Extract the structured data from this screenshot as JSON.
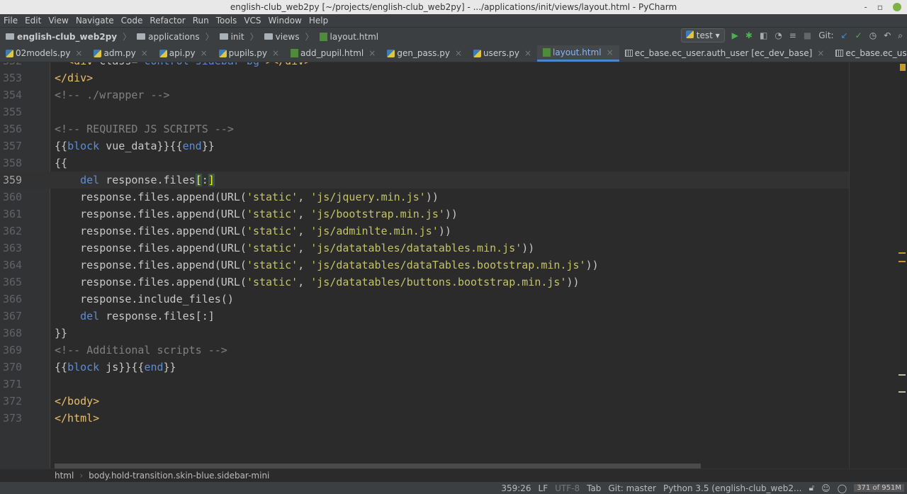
{
  "window": {
    "title": "english-club_web2py [~/projects/english-club_web2py] - .../applications/init/views/layout.html - PyCharm"
  },
  "menu": [
    "File",
    "Edit",
    "View",
    "Navigate",
    "Code",
    "Refactor",
    "Run",
    "Tools",
    "VCS",
    "Window",
    "Help"
  ],
  "breadcrumb": [
    "english-club_web2py",
    "applications",
    "init",
    "views",
    "layout.html"
  ],
  "toolbar": {
    "run_config": "test",
    "git_label": "Git:"
  },
  "tabs": [
    {
      "label": "02models.py",
      "icon": "python"
    },
    {
      "label": "adm.py",
      "icon": "python"
    },
    {
      "label": "api.py",
      "icon": "python"
    },
    {
      "label": "pupils.py",
      "icon": "python"
    },
    {
      "label": "add_pupil.html",
      "icon": "html"
    },
    {
      "label": "gen_pass.py",
      "icon": "python"
    },
    {
      "label": "users.py",
      "icon": "python"
    },
    {
      "label": "layout.html",
      "icon": "html",
      "active": true
    },
    {
      "label": "ec_base.ec_user.auth_user [ec_dev_base]",
      "icon": "table"
    },
    {
      "label": "ec_base.ec_user.group_pupils [ec_dev_bas",
      "icon": "table"
    }
  ],
  "code": [
    {
      "n": "352",
      "tokens": [
        [
          "tg",
          "  <div "
        ],
        [
          "p",
          "class="
        ],
        [
          "k",
          "\"control-sidebar-bg\""
        ],
        [
          "tg",
          "></div>"
        ]
      ]
    },
    {
      "n": "353",
      "tokens": [
        [
          "tg",
          "</div>"
        ]
      ]
    },
    {
      "n": "354",
      "tokens": [
        [
          "cm",
          "<!-- ./wrapper -->"
        ]
      ]
    },
    {
      "n": "355",
      "tokens": []
    },
    {
      "n": "356",
      "tokens": [
        [
          "cm",
          "<!-- REQUIRED JS SCRIPTS -->"
        ]
      ]
    },
    {
      "n": "357",
      "tokens": [
        [
          "p",
          "{{"
        ],
        [
          "k",
          "block"
        ],
        [
          "p",
          " vue_data}}{{"
        ],
        [
          "k",
          "end"
        ],
        [
          "p",
          "}}"
        ]
      ]
    },
    {
      "n": "358",
      "tokens": [
        [
          "p",
          "{{"
        ]
      ]
    },
    {
      "n": "359",
      "cur": true,
      "tokens": [
        [
          "p",
          "    "
        ],
        [
          "k",
          "del"
        ],
        [
          "p",
          " response.files"
        ],
        [
          "br",
          "["
        ],
        [
          "p",
          ":"
        ],
        [
          "br",
          "]"
        ]
      ]
    },
    {
      "n": "360",
      "tokens": [
        [
          "p",
          "    response.files.append(URL("
        ],
        [
          "s",
          "'static'"
        ],
        [
          "p",
          ", "
        ],
        [
          "s",
          "'js/jquery.min.js'"
        ],
        [
          "p",
          "))"
        ]
      ]
    },
    {
      "n": "361",
      "tokens": [
        [
          "p",
          "    response.files.append(URL("
        ],
        [
          "s",
          "'static'"
        ],
        [
          "p",
          ", "
        ],
        [
          "s",
          "'js/bootstrap.min.js'"
        ],
        [
          "p",
          "))"
        ]
      ]
    },
    {
      "n": "362",
      "tokens": [
        [
          "p",
          "    response.files.append(URL("
        ],
        [
          "s",
          "'static'"
        ],
        [
          "p",
          ", "
        ],
        [
          "s",
          "'js/adminlte.min.js'"
        ],
        [
          "p",
          "))"
        ]
      ]
    },
    {
      "n": "363",
      "tokens": [
        [
          "p",
          "    response.files.append(URL("
        ],
        [
          "s",
          "'static'"
        ],
        [
          "p",
          ", "
        ],
        [
          "s",
          "'js/datatables/datatables.min.js'"
        ],
        [
          "p",
          "))"
        ]
      ]
    },
    {
      "n": "364",
      "tokens": [
        [
          "p",
          "    response.files.append(URL("
        ],
        [
          "s",
          "'static'"
        ],
        [
          "p",
          ", "
        ],
        [
          "s",
          "'js/datatables/dataTables.bootstrap.min.js'"
        ],
        [
          "p",
          "))"
        ]
      ]
    },
    {
      "n": "365",
      "tokens": [
        [
          "p",
          "    response.files.append(URL("
        ],
        [
          "s",
          "'static'"
        ],
        [
          "p",
          ", "
        ],
        [
          "s",
          "'js/datatables/buttons.bootstrap.min.js'"
        ],
        [
          "p",
          "))"
        ]
      ]
    },
    {
      "n": "366",
      "tokens": [
        [
          "p",
          "    response.include_files()"
        ]
      ]
    },
    {
      "n": "367",
      "tokens": [
        [
          "p",
          "    "
        ],
        [
          "k",
          "del"
        ],
        [
          "p",
          " response.files[:]"
        ]
      ]
    },
    {
      "n": "368",
      "tokens": [
        [
          "p",
          "}}"
        ]
      ]
    },
    {
      "n": "369",
      "tokens": [
        [
          "cm",
          "<!-- Additional scripts -->"
        ]
      ]
    },
    {
      "n": "370",
      "tokens": [
        [
          "p",
          "{{"
        ],
        [
          "k",
          "block"
        ],
        [
          "p",
          " js}}{{"
        ],
        [
          "k",
          "end"
        ],
        [
          "p",
          "}}"
        ]
      ]
    },
    {
      "n": "371",
      "tokens": []
    },
    {
      "n": "372",
      "tokens": [
        [
          "tg",
          "</body>"
        ]
      ]
    },
    {
      "n": "373",
      "tokens": [
        [
          "tg",
          "</html>"
        ]
      ]
    }
  ],
  "path_bar": [
    "html",
    "body.hold-transition.skin-blue.sidebar-mini"
  ],
  "status": {
    "position": "359:26",
    "line_sep": "LF",
    "encoding": "UTF-8",
    "indent": "Tab",
    "git": "Git: master",
    "interpreter": "Python 3.5 (english-club_web2...",
    "memory": "371 of 951M"
  }
}
